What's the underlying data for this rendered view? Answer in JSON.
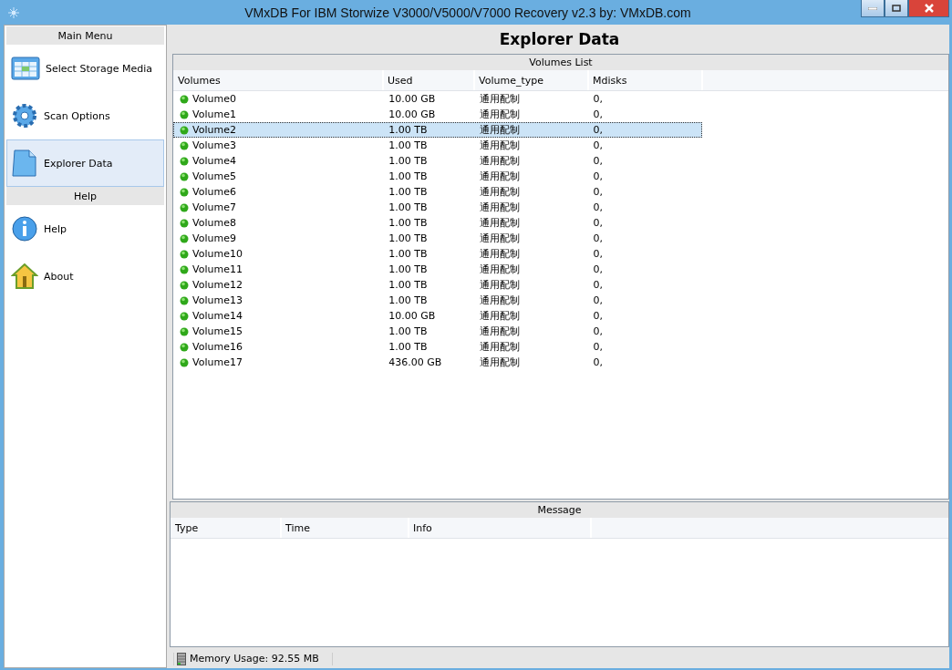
{
  "window": {
    "title": "VMxDB For IBM Storwize V3000/V5000/V7000 Recovery v2.3 by: VMxDB.com"
  },
  "sidebar": {
    "sections": [
      {
        "header": "Main Menu",
        "items": [
          {
            "label": "Select Storage Media",
            "kind": "media",
            "selected": false
          },
          {
            "label": "Scan Options",
            "kind": "gear",
            "selected": false
          },
          {
            "label": "Explorer Data",
            "kind": "document",
            "selected": true
          }
        ]
      },
      {
        "header": "Help",
        "items": [
          {
            "label": "Help",
            "kind": "info",
            "selected": false
          },
          {
            "label": "About",
            "kind": "house",
            "selected": false
          }
        ]
      }
    ]
  },
  "page_title": "Explorer Data",
  "volumes_list": {
    "title": "Volumes List",
    "columns": [
      "Volumes",
      "Used",
      "Volume_type",
      "Mdisks"
    ],
    "rows": [
      {
        "name": "Volume0",
        "used": "10.00 GB",
        "type": "通用配制",
        "mdisks": "0,",
        "selected": false
      },
      {
        "name": "Volume1",
        "used": "10.00 GB",
        "type": "通用配制",
        "mdisks": "0,",
        "selected": false
      },
      {
        "name": "Volume2",
        "used": "1.00 TB",
        "type": "通用配制",
        "mdisks": "0,",
        "selected": true
      },
      {
        "name": "Volume3",
        "used": "1.00 TB",
        "type": "通用配制",
        "mdisks": "0,",
        "selected": false
      },
      {
        "name": "Volume4",
        "used": "1.00 TB",
        "type": "通用配制",
        "mdisks": "0,",
        "selected": false
      },
      {
        "name": "Volume5",
        "used": "1.00 TB",
        "type": "通用配制",
        "mdisks": "0,",
        "selected": false
      },
      {
        "name": "Volume6",
        "used": "1.00 TB",
        "type": "通用配制",
        "mdisks": "0,",
        "selected": false
      },
      {
        "name": "Volume7",
        "used": "1.00 TB",
        "type": "通用配制",
        "mdisks": "0,",
        "selected": false
      },
      {
        "name": "Volume8",
        "used": "1.00 TB",
        "type": "通用配制",
        "mdisks": "0,",
        "selected": false
      },
      {
        "name": "Volume9",
        "used": "1.00 TB",
        "type": "通用配制",
        "mdisks": "0,",
        "selected": false
      },
      {
        "name": "Volume10",
        "used": "1.00 TB",
        "type": "通用配制",
        "mdisks": "0,",
        "selected": false
      },
      {
        "name": "Volume11",
        "used": "1.00 TB",
        "type": "通用配制",
        "mdisks": "0,",
        "selected": false
      },
      {
        "name": "Volume12",
        "used": "1.00 TB",
        "type": "通用配制",
        "mdisks": "0,",
        "selected": false
      },
      {
        "name": "Volume13",
        "used": "1.00 TB",
        "type": "通用配制",
        "mdisks": "0,",
        "selected": false
      },
      {
        "name": "Volume14",
        "used": "10.00 GB",
        "type": "通用配制",
        "mdisks": "0,",
        "selected": false
      },
      {
        "name": "Volume15",
        "used": "1.00 TB",
        "type": "通用配制",
        "mdisks": "0,",
        "selected": false
      },
      {
        "name": "Volume16",
        "used": "1.00 TB",
        "type": "通用配制",
        "mdisks": "0,",
        "selected": false
      },
      {
        "name": "Volume17",
        "used": "436.00 GB",
        "type": "通用配制",
        "mdisks": "0,",
        "selected": false
      }
    ]
  },
  "message": {
    "title": "Message",
    "columns": [
      "Type",
      "Time",
      "Info"
    ]
  },
  "status_bar": {
    "memory": "Memory Usage: 92.55 MB"
  }
}
